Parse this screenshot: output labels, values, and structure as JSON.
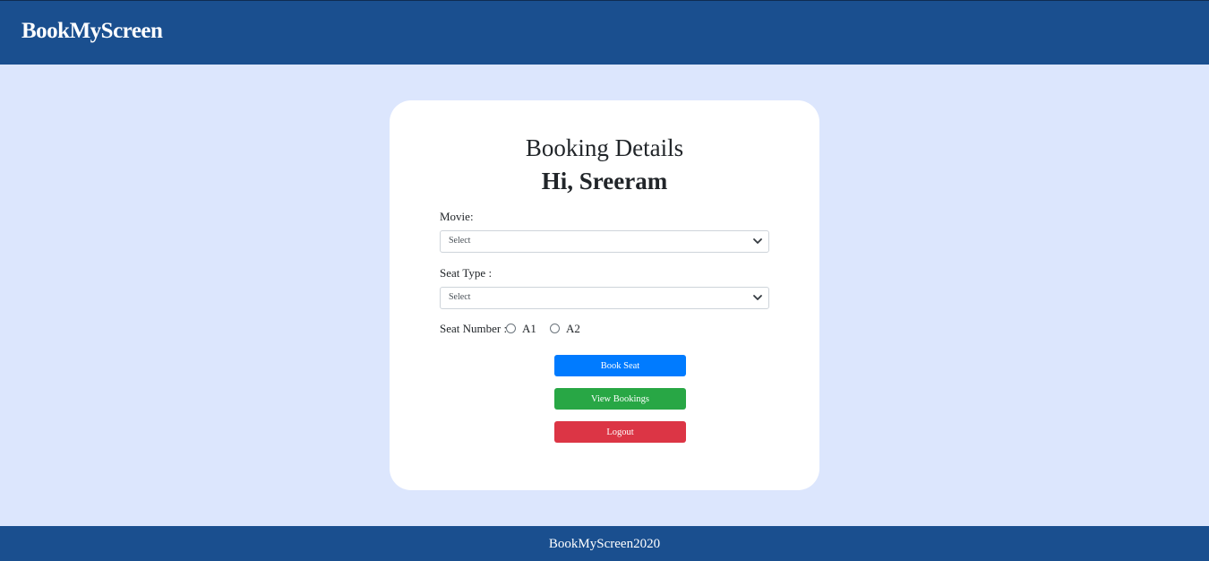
{
  "navbar": {
    "brand": "BookMyScreen"
  },
  "card": {
    "title": "Booking Details",
    "greeting": "Hi, Sreeram",
    "movie": {
      "label": "Movie:",
      "selected": "Select",
      "icon": "chevron-down-icon"
    },
    "seat_type": {
      "label": "Seat Type :",
      "selected": "Select",
      "icon": "chevron-down-icon"
    },
    "seat_number": {
      "label": "Seat Number :",
      "options": [
        "A1",
        "A2"
      ]
    },
    "buttons": {
      "book": "Book Seat",
      "view": "View Bookings",
      "logout": "Logout"
    }
  },
  "footer": {
    "text": "BookMyScreen2020"
  },
  "colors": {
    "header_bg": "#1a4f8f",
    "page_bg": "#dce6fd",
    "primary": "#007bff",
    "success": "#28a745",
    "danger": "#dc3545"
  }
}
